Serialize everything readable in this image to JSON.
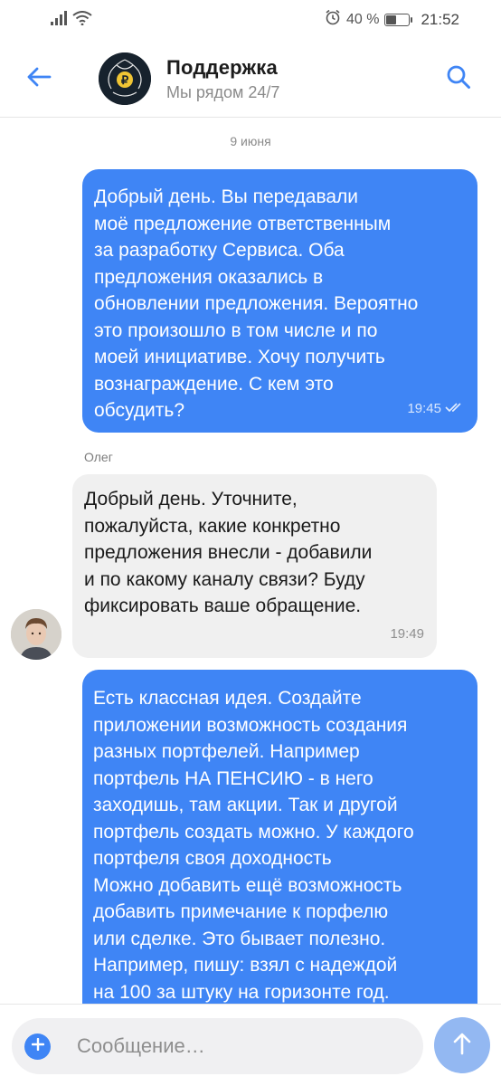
{
  "status_bar": {
    "battery_text": "40 %",
    "battery_level": 0.4,
    "time": "21:52",
    "icons": [
      "signal-icon",
      "wifi-icon",
      "alarm-icon",
      "battery-icon"
    ]
  },
  "header": {
    "title": "Поддержка",
    "subtitle": "Мы рядом 24/7",
    "back_icon": "arrow-left-icon",
    "search_icon": "search-icon"
  },
  "chat": {
    "date_divider": "9 июня",
    "messages": [
      {
        "direction": "outgoing",
        "text": "Добрый день. Вы передавали\nмоё предложение ответственным\nза разработку Сервиса. Оба\nпредложения оказались в\nобновлении предложения. Вероятно\nэто произошло в том числе и по\nмоей инициативе. Хочу получить\nвознаграждение. С кем это\nобсудить?",
        "time": "19:45",
        "status_icon": "double-check-icon"
      },
      {
        "direction": "incoming",
        "sender": "Олег",
        "text": "Добрый день. Уточните,\nпожалуйста, какие конкретно\nпредложения внесли - добавили\nи по какому каналу связи? Буду\nфиксировать ваше обращение.",
        "time": "19:49"
      },
      {
        "direction": "outgoing",
        "text": "Есть классная идея. Создайте\nприложении возможность создания\nразных портфелей. Например\nпортфель НА ПЕНСИЮ - в него\nзаходишь, там акции. Так и другой\nпортфель создать можно. У каждого\nпортфеля своя доходность\nМожно добавить ещё возможность\nдобавить примечание к порфелю\nили сделке. Это бывает полезно.\nНапример, пишу: взял с надеждой\nна 100 за штуку на горизонте год."
      }
    ]
  },
  "composer": {
    "placeholder": "Сообщение…",
    "attach_icon": "plus-icon",
    "send_icon": "arrow-up-icon"
  },
  "colors": {
    "accent": "#3f85f5",
    "incoming_bubble": "#f0f0f0",
    "send_button_disabled": "#93b8f2"
  }
}
